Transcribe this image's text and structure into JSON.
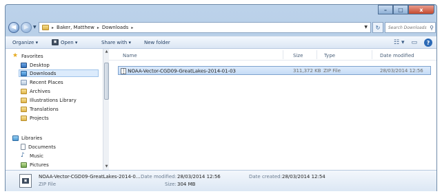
{
  "window": {
    "controls": {
      "minimize": "–",
      "maximize": "□",
      "close": "x"
    }
  },
  "address": {
    "back_glyph": "◀",
    "forward_glyph": "▶",
    "dropdown_glyph": "▼",
    "separator": "▸",
    "breadcrumbs": [
      "Baker, Matthew",
      "Downloads"
    ],
    "refresh_glyph": "↻",
    "search_placeholder": "Search Downloads",
    "search_icon": "⚲"
  },
  "toolbar": {
    "organize": "Organize ▾",
    "open_icon_text": "▣",
    "open": "Open ▾",
    "share": "Share with ▾",
    "new_folder": "New folder",
    "view_icon": "☷ ▾",
    "preview_icon": "▭",
    "help": "?"
  },
  "nav": {
    "favorites_header": "Favorites",
    "favorites": [
      "Desktop",
      "Downloads",
      "Recent Places",
      "Archives",
      "Illustrations Library",
      "Translations",
      "Projects"
    ],
    "libraries_header": "Libraries",
    "libraries": [
      "Documents",
      "Music",
      "Pictures"
    ],
    "star_glyph": "★",
    "music_glyph": "♪",
    "scroll_up": "▲",
    "scroll_down": "▼"
  },
  "columns": {
    "name": "Name",
    "size": "Size",
    "type": "Type",
    "date_modified": "Date modified"
  },
  "files": [
    {
      "name": "NOAA-Vector-CGD09-GreatLakes-2014-01-03",
      "size": "311,372 KB",
      "type": "ZIP File",
      "date_modified": "28/03/2014 12:56"
    }
  ],
  "details": {
    "thumb_text": "▣",
    "name": "NOAA-Vector-CGD09-GreatLakes-2014-0...",
    "type": "ZIP File",
    "date_modified_label": "Date modified:",
    "date_modified": "28/03/2014 12:56",
    "size_label": "Size:",
    "size": "304 MB",
    "date_created_label": "Date created:",
    "date_created": "28/03/2014 12:54"
  }
}
